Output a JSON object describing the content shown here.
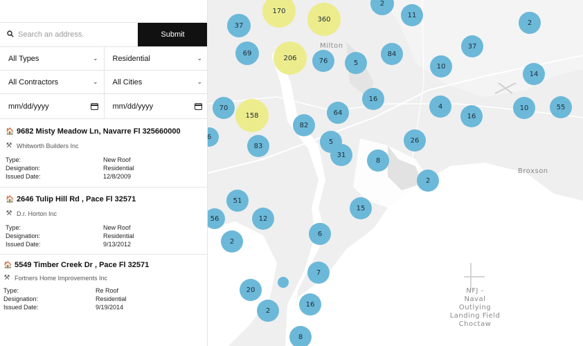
{
  "search": {
    "placeholder": "Search an address.",
    "submit_label": "Submit"
  },
  "filters": {
    "type": "All Types",
    "designation": "Residential",
    "contractor": "All Contractors",
    "city": "All Cities",
    "date_from": "mm/dd/yyyy",
    "date_to": "mm/dd/yyyy"
  },
  "labels": {
    "type": "Type:",
    "designation": "Designation:",
    "issued": "Issued Date:"
  },
  "listings": [
    {
      "address": "9682 Misty Meadow Ln, Navarre Fl 325660000",
      "contractor": "Whitworth Builders Inc",
      "type": "New Roof",
      "designation": "Residential",
      "issued": "12/8/2009"
    },
    {
      "address": "2646 Tulip Hill Rd , Pace Fl 32571",
      "contractor": "D.r. Horton Inc",
      "type": "New Roof",
      "designation": "Residential",
      "issued": "9/13/2012"
    },
    {
      "address": "5549 Timber Creek Dr , Pace Fl 32571",
      "contractor": "Fortners Home Improvements Inc",
      "type": "Re Roof",
      "designation": "Residential",
      "issued": "9/19/2014"
    }
  ],
  "map": {
    "place_labels": [
      "Milton",
      "Broxson",
      "NFJ -\nNaval Outlying\nLanding Field\nChoctaw"
    ],
    "clusters": [
      {
        "n": "2",
        "c": "blue"
      },
      {
        "n": "11",
        "c": "blue"
      },
      {
        "n": "170",
        "c": "yellow"
      },
      {
        "n": "360",
        "c": "yellow"
      },
      {
        "n": "37",
        "c": "blue"
      },
      {
        "n": "2",
        "c": "blue"
      },
      {
        "n": "69",
        "c": "blue"
      },
      {
        "n": "206",
        "c": "yellow"
      },
      {
        "n": "76",
        "c": "blue"
      },
      {
        "n": "5",
        "c": "blue"
      },
      {
        "n": "84",
        "c": "blue"
      },
      {
        "n": "37",
        "c": "blue"
      },
      {
        "n": "10",
        "c": "blue"
      },
      {
        "n": "14",
        "c": "blue"
      },
      {
        "n": "70",
        "c": "blue"
      },
      {
        "n": "158",
        "c": "yellow"
      },
      {
        "n": "16",
        "c": "blue"
      },
      {
        "n": "64",
        "c": "blue"
      },
      {
        "n": "4",
        "c": "blue"
      },
      {
        "n": "16",
        "c": "blue"
      },
      {
        "n": "10",
        "c": "blue"
      },
      {
        "n": "55",
        "c": "blue"
      },
      {
        "n": "6",
        "c": "blue"
      },
      {
        "n": "82",
        "c": "blue"
      },
      {
        "n": "83",
        "c": "blue"
      },
      {
        "n": "5",
        "c": "blue"
      },
      {
        "n": "31",
        "c": "blue"
      },
      {
        "n": "26",
        "c": "blue"
      },
      {
        "n": "8",
        "c": "blue"
      },
      {
        "n": "2",
        "c": "blue"
      },
      {
        "n": "51",
        "c": "blue"
      },
      {
        "n": "15",
        "c": "blue"
      },
      {
        "n": "56",
        "c": "blue"
      },
      {
        "n": "12",
        "c": "blue"
      },
      {
        "n": "6",
        "c": "blue"
      },
      {
        "n": "2",
        "c": "blue"
      },
      {
        "n": "7",
        "c": "blue"
      },
      {
        "n": "20",
        "c": "blue"
      },
      {
        "n": "",
        "c": "blue"
      },
      {
        "n": "16",
        "c": "blue"
      },
      {
        "n": "2",
        "c": "blue"
      },
      {
        "n": "8",
        "c": "blue"
      }
    ]
  }
}
